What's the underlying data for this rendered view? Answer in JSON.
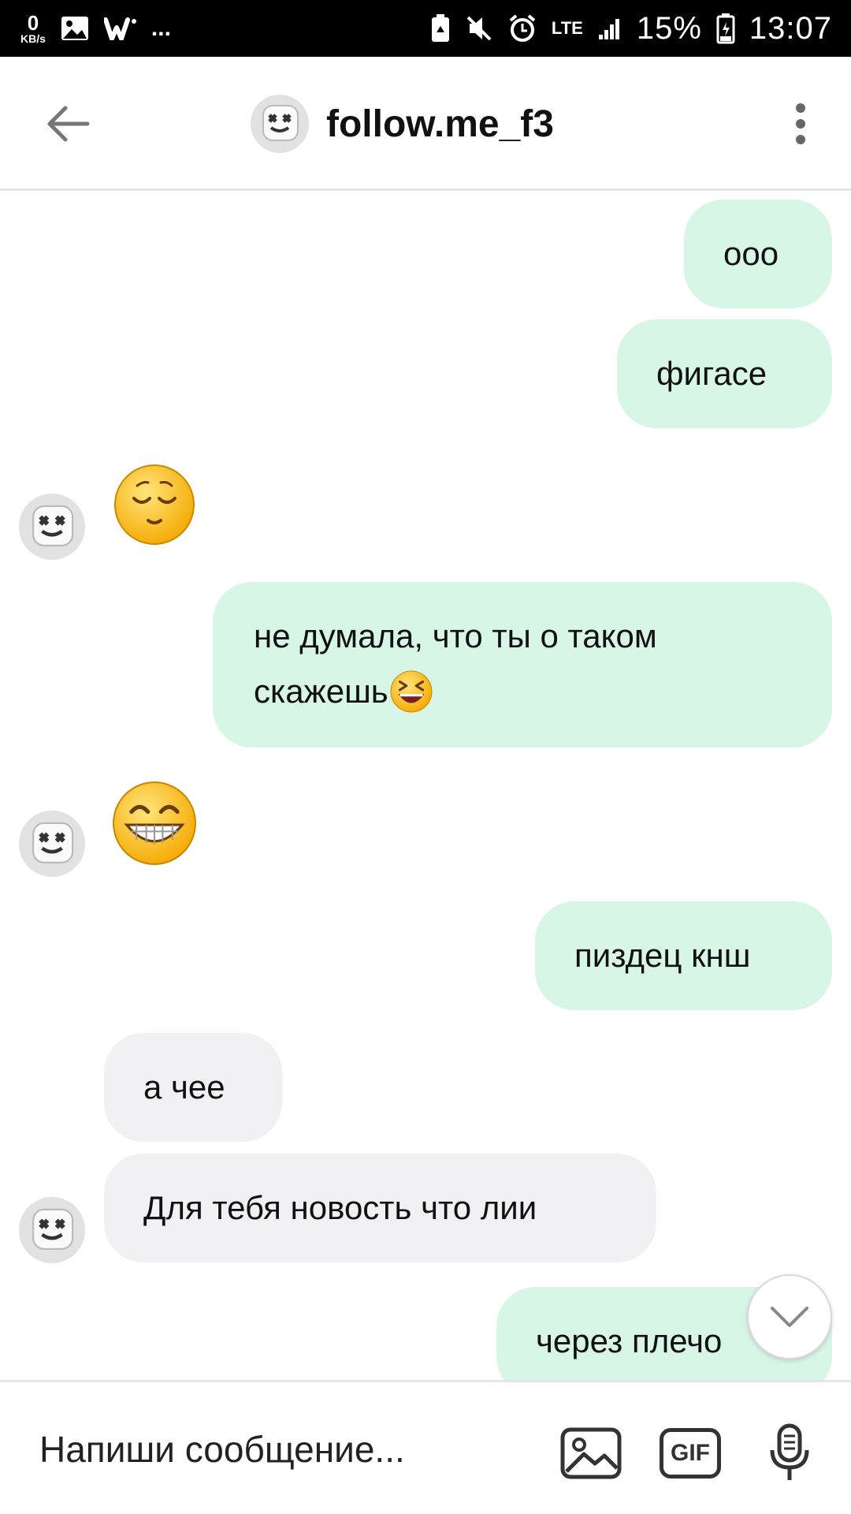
{
  "status_bar": {
    "net_speed_value": "0",
    "net_speed_unit": "KB/s",
    "more": "...",
    "lte": "LTE",
    "battery": "15%",
    "time": "13:07"
  },
  "header": {
    "title": "follow.me_f3"
  },
  "messages": [
    {
      "side": "me",
      "text": "ооо"
    },
    {
      "side": "me",
      "text": "фигасе"
    },
    {
      "side": "them",
      "emoji": "relieved"
    },
    {
      "side": "me",
      "text_line1": "не думала, что ты о таком",
      "text_line2": "скажешь"
    },
    {
      "side": "them",
      "emoji": "grin"
    },
    {
      "side": "me",
      "text": "пиздец кнш"
    },
    {
      "side": "them",
      "text": "а чее"
    },
    {
      "side": "them",
      "text": "Для тебя новость что лии"
    },
    {
      "side": "me",
      "text": "через плечо"
    }
  ],
  "input": {
    "placeholder": "Напиши сообщение...",
    "gif_label": "GIF"
  },
  "icons": {
    "back": "back-arrow-icon",
    "menu": "more-vert-icon",
    "image": "image-icon",
    "gif": "gif-icon",
    "mic": "microphone-icon",
    "scroll": "chevron-down-icon"
  },
  "colors": {
    "my_bubble": "#d8f6e5",
    "their_bubble": "#f1f0f2"
  }
}
